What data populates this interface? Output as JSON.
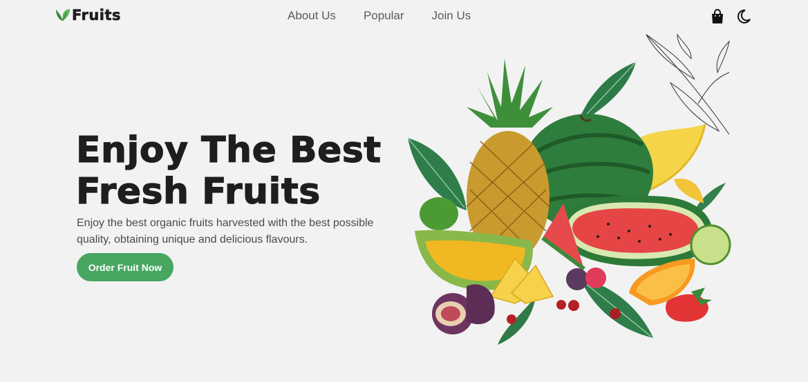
{
  "header": {
    "logo_text": "Fruits",
    "nav": [
      {
        "label": "About Us"
      },
      {
        "label": "Popular"
      },
      {
        "label": "Join Us"
      }
    ],
    "icons": [
      "shopping-bag-icon",
      "moon-icon"
    ]
  },
  "hero": {
    "title_line1": "Enjoy The Best",
    "title_line2": "Fresh Fruits",
    "description": "Enjoy the best organic fruits harvested with the best possible quality, obtaining unique and delicious flavours.",
    "cta_label": "Order Fruit Now"
  },
  "colors": {
    "background": "#f2f2f2",
    "accent": "#47a660",
    "text": "#1e1e1e"
  }
}
